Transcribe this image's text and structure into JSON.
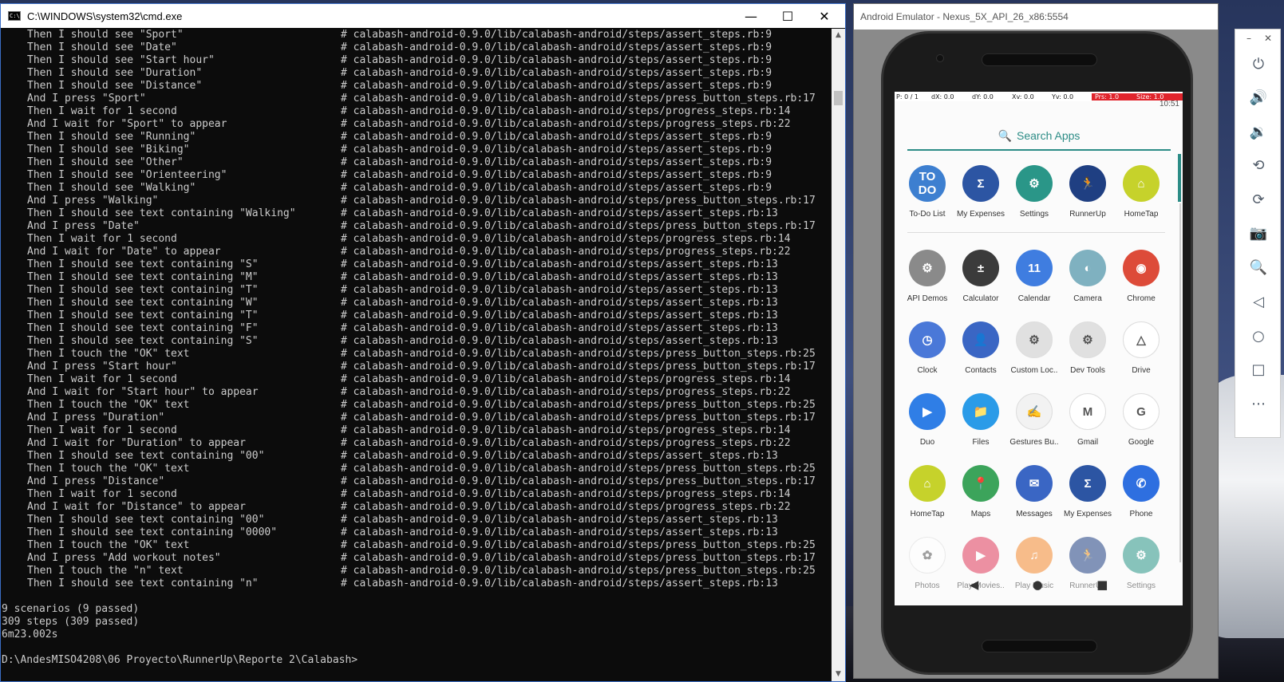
{
  "cmd": {
    "title": "C:\\WINDOWS\\system32\\cmd.exe",
    "icon_text": "C:\\",
    "minimize": "—",
    "maximize": "☐",
    "close": "✕",
    "lines": [
      {
        "step": "Then I should see \"Sport\"",
        "loc": "# calabash-android-0.9.0/lib/calabash-android/steps/assert_steps.rb:9"
      },
      {
        "step": "Then I should see \"Date\"",
        "loc": "# calabash-android-0.9.0/lib/calabash-android/steps/assert_steps.rb:9"
      },
      {
        "step": "Then I should see \"Start hour\"",
        "loc": "# calabash-android-0.9.0/lib/calabash-android/steps/assert_steps.rb:9"
      },
      {
        "step": "Then I should see \"Duration\"",
        "loc": "# calabash-android-0.9.0/lib/calabash-android/steps/assert_steps.rb:9"
      },
      {
        "step": "Then I should see \"Distance\"",
        "loc": "# calabash-android-0.9.0/lib/calabash-android/steps/assert_steps.rb:9"
      },
      {
        "step": "And I press \"Sport\"",
        "loc": "# calabash-android-0.9.0/lib/calabash-android/steps/press_button_steps.rb:17"
      },
      {
        "step": "Then I wait for 1 second",
        "loc": "# calabash-android-0.9.0/lib/calabash-android/steps/progress_steps.rb:14"
      },
      {
        "step": "And I wait for \"Sport\" to appear",
        "loc": "# calabash-android-0.9.0/lib/calabash-android/steps/progress_steps.rb:22"
      },
      {
        "step": "Then I should see \"Running\"",
        "loc": "# calabash-android-0.9.0/lib/calabash-android/steps/assert_steps.rb:9"
      },
      {
        "step": "Then I should see \"Biking\"",
        "loc": "# calabash-android-0.9.0/lib/calabash-android/steps/assert_steps.rb:9"
      },
      {
        "step": "Then I should see \"Other\"",
        "loc": "# calabash-android-0.9.0/lib/calabash-android/steps/assert_steps.rb:9"
      },
      {
        "step": "Then I should see \"Orienteering\"",
        "loc": "# calabash-android-0.9.0/lib/calabash-android/steps/assert_steps.rb:9"
      },
      {
        "step": "Then I should see \"Walking\"",
        "loc": "# calabash-android-0.9.0/lib/calabash-android/steps/assert_steps.rb:9"
      },
      {
        "step": "And I press \"Walking\"",
        "loc": "# calabash-android-0.9.0/lib/calabash-android/steps/press_button_steps.rb:17"
      },
      {
        "step": "Then I should see text containing \"Walking\"",
        "loc": "# calabash-android-0.9.0/lib/calabash-android/steps/assert_steps.rb:13"
      },
      {
        "step": "And I press \"Date\"",
        "loc": "# calabash-android-0.9.0/lib/calabash-android/steps/press_button_steps.rb:17"
      },
      {
        "step": "Then I wait for 1 second",
        "loc": "# calabash-android-0.9.0/lib/calabash-android/steps/progress_steps.rb:14"
      },
      {
        "step": "And I wait for \"Date\" to appear",
        "loc": "# calabash-android-0.9.0/lib/calabash-android/steps/progress_steps.rb:22"
      },
      {
        "step": "Then I should see text containing \"S\"",
        "loc": "# calabash-android-0.9.0/lib/calabash-android/steps/assert_steps.rb:13"
      },
      {
        "step": "Then I should see text containing \"M\"",
        "loc": "# calabash-android-0.9.0/lib/calabash-android/steps/assert_steps.rb:13"
      },
      {
        "step": "Then I should see text containing \"T\"",
        "loc": "# calabash-android-0.9.0/lib/calabash-android/steps/assert_steps.rb:13"
      },
      {
        "step": "Then I should see text containing \"W\"",
        "loc": "# calabash-android-0.9.0/lib/calabash-android/steps/assert_steps.rb:13"
      },
      {
        "step": "Then I should see text containing \"T\"",
        "loc": "# calabash-android-0.9.0/lib/calabash-android/steps/assert_steps.rb:13"
      },
      {
        "step": "Then I should see text containing \"F\"",
        "loc": "# calabash-android-0.9.0/lib/calabash-android/steps/assert_steps.rb:13"
      },
      {
        "step": "Then I should see text containing \"S\"",
        "loc": "# calabash-android-0.9.0/lib/calabash-android/steps/assert_steps.rb:13"
      },
      {
        "step": "Then I touch the \"OK\" text",
        "loc": "# calabash-android-0.9.0/lib/calabash-android/steps/press_button_steps.rb:25"
      },
      {
        "step": "And I press \"Start hour\"",
        "loc": "# calabash-android-0.9.0/lib/calabash-android/steps/press_button_steps.rb:17"
      },
      {
        "step": "Then I wait for 1 second",
        "loc": "# calabash-android-0.9.0/lib/calabash-android/steps/progress_steps.rb:14"
      },
      {
        "step": "And I wait for \"Start hour\" to appear",
        "loc": "# calabash-android-0.9.0/lib/calabash-android/steps/progress_steps.rb:22"
      },
      {
        "step": "Then I touch the \"OK\" text",
        "loc": "# calabash-android-0.9.0/lib/calabash-android/steps/press_button_steps.rb:25"
      },
      {
        "step": "And I press \"Duration\"",
        "loc": "# calabash-android-0.9.0/lib/calabash-android/steps/press_button_steps.rb:17"
      },
      {
        "step": "Then I wait for 1 second",
        "loc": "# calabash-android-0.9.0/lib/calabash-android/steps/progress_steps.rb:14"
      },
      {
        "step": "And I wait for \"Duration\" to appear",
        "loc": "# calabash-android-0.9.0/lib/calabash-android/steps/progress_steps.rb:22"
      },
      {
        "step": "Then I should see text containing \"00\"",
        "loc": "# calabash-android-0.9.0/lib/calabash-android/steps/assert_steps.rb:13"
      },
      {
        "step": "Then I touch the \"OK\" text",
        "loc": "# calabash-android-0.9.0/lib/calabash-android/steps/press_button_steps.rb:25"
      },
      {
        "step": "And I press \"Distance\"",
        "loc": "# calabash-android-0.9.0/lib/calabash-android/steps/press_button_steps.rb:17"
      },
      {
        "step": "Then I wait for 1 second",
        "loc": "# calabash-android-0.9.0/lib/calabash-android/steps/progress_steps.rb:14"
      },
      {
        "step": "And I wait for \"Distance\" to appear",
        "loc": "# calabash-android-0.9.0/lib/calabash-android/steps/progress_steps.rb:22"
      },
      {
        "step": "Then I should see text containing \"00\"",
        "loc": "# calabash-android-0.9.0/lib/calabash-android/steps/assert_steps.rb:13"
      },
      {
        "step": "Then I should see text containing \"0000\"",
        "loc": "# calabash-android-0.9.0/lib/calabash-android/steps/assert_steps.rb:13"
      },
      {
        "step": "Then I touch the \"OK\" text",
        "loc": "# calabash-android-0.9.0/lib/calabash-android/steps/press_button_steps.rb:25"
      },
      {
        "step": "And I press \"Add workout notes\"",
        "loc": "# calabash-android-0.9.0/lib/calabash-android/steps/press_button_steps.rb:17"
      },
      {
        "step": "Then I touch the \"n\" text",
        "loc": "# calabash-android-0.9.0/lib/calabash-android/steps/press_button_steps.rb:25"
      },
      {
        "step": "Then I should see text containing \"n\"",
        "loc": "# calabash-android-0.9.0/lib/calabash-android/steps/assert_steps.rb:13"
      }
    ],
    "summary": [
      "9 scenarios (9 passed)",
      "309 steps (309 passed)",
      "6m23.002s"
    ],
    "prompt": "D:\\AndesMISO4208\\06 Proyecto\\RunnerUp\\Reporte 2\\Calabash>"
  },
  "emulator": {
    "title": "Android Emulator - Nexus_5X_API_26_x86:5554",
    "overlay": [
      "P: 0 / 1",
      "dX: 0.0",
      "dY: 0.0",
      "Xv: 0.0",
      "Yv: 0.0",
      "Prs: 1.0",
      "Size: 1.0"
    ],
    "time": "10:51",
    "search_label": "Search Apps",
    "apps": [
      {
        "label": "To-Do List",
        "glyph": "TO DO",
        "color": "#3d7fd0"
      },
      {
        "label": "My Expenses",
        "glyph": "Σ",
        "color": "#2c55a3"
      },
      {
        "label": "Settings",
        "glyph": "⚙",
        "color": "#2a9688"
      },
      {
        "label": "RunnerUp",
        "glyph": "🏃",
        "color": "#1f3f82"
      },
      {
        "label": "HomeTap",
        "glyph": "⌂",
        "color": "#c6d22b"
      },
      {
        "label": "API Demos",
        "glyph": "⚙",
        "color": "#8a8a8a"
      },
      {
        "label": "Calculator",
        "glyph": "±",
        "color": "#3b3b3b"
      },
      {
        "label": "Calendar",
        "glyph": "11",
        "color": "#3f7de0"
      },
      {
        "label": "Camera",
        "glyph": "◐",
        "color": "#7fb1c0"
      },
      {
        "label": "Chrome",
        "glyph": "◉",
        "color": "#dd4b39"
      },
      {
        "label": "Clock",
        "glyph": "◷",
        "color": "#4a78d8"
      },
      {
        "label": "Contacts",
        "glyph": "👤",
        "color": "#3a66c4"
      },
      {
        "label": "Custom Loc..",
        "glyph": "⚙",
        "color": "#e0e0e0"
      },
      {
        "label": "Dev Tools",
        "glyph": "⚙",
        "color": "#e0e0e0"
      },
      {
        "label": "Drive",
        "glyph": "△",
        "color": "#ffffff"
      },
      {
        "label": "Duo",
        "glyph": "▶",
        "color": "#2f7ee6"
      },
      {
        "label": "Files",
        "glyph": "📁",
        "color": "#2a9be8"
      },
      {
        "label": "Gestures Bu..",
        "glyph": "✍",
        "color": "#f2f2f2"
      },
      {
        "label": "Gmail",
        "glyph": "M",
        "color": "#ffffff"
      },
      {
        "label": "Google",
        "glyph": "G",
        "color": "#ffffff"
      },
      {
        "label": "HomeTap",
        "glyph": "⌂",
        "color": "#c6d22b"
      },
      {
        "label": "Maps",
        "glyph": "📍",
        "color": "#3ca45b"
      },
      {
        "label": "Messages",
        "glyph": "✉",
        "color": "#3a66c4"
      },
      {
        "label": "My Expenses",
        "glyph": "Σ",
        "color": "#2c55a3"
      },
      {
        "label": "Phone",
        "glyph": "✆",
        "color": "#2e6fe0"
      },
      {
        "label": "Photos",
        "glyph": "✿",
        "color": "#ffffff"
      },
      {
        "label": "Play Movies..",
        "glyph": "▶",
        "color": "#e03a5a"
      },
      {
        "label": "Play Music",
        "glyph": "♫",
        "color": "#f58a2e"
      },
      {
        "label": "RunnerUp",
        "glyph": "🏃",
        "color": "#1f3f82"
      },
      {
        "label": "Settings",
        "glyph": "⚙",
        "color": "#2a9688"
      }
    ],
    "toolbar": [
      "⏻",
      "🔊",
      "🔉",
      "⟲",
      "⟳",
      "📷",
      "🔍",
      "◁",
      "○",
      "□",
      "⋯"
    ]
  }
}
